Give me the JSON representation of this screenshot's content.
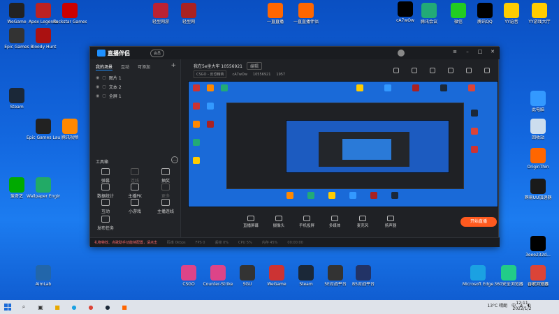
{
  "desktop": {
    "icons_left": [
      {
        "label": "WeGame",
        "color": "#222"
      },
      {
        "label": "Apex Legends",
        "color": "#b22"
      },
      {
        "label": "Rockstar Games",
        "color": "#c00"
      },
      {
        "label": "Epic Games",
        "color": "#333"
      },
      {
        "label": "Bloody Hunt",
        "color": "#a11"
      },
      {
        "label": "Steam",
        "color": "#1b2838"
      },
      {
        "label": "Epic Games Launcher",
        "color": "#222"
      },
      {
        "label": "腾讯视频",
        "color": "#f80"
      },
      {
        "label": "爱奇艺",
        "color": "#0a0"
      },
      {
        "label": "Wallpaper Engine",
        "color": "#2a6"
      },
      {
        "label": "AimLab",
        "color": "#26a"
      }
    ],
    "icons_top": [
      {
        "label": "轻型网游",
        "color": "#b23"
      },
      {
        "label": "轻型网",
        "color": "#a22"
      },
      {
        "label": "一直直播",
        "color": "#f60"
      },
      {
        "label": "一直直播伴侣",
        "color": "#f60"
      },
      {
        "label": "cA7wOw",
        "color": "#000"
      },
      {
        "label": "腾讯会议",
        "color": "#2a7"
      },
      {
        "label": "微信",
        "color": "#2c2"
      },
      {
        "label": "腾讯QQ",
        "color": "#000"
      },
      {
        "label": "YY语音",
        "color": "#fc0"
      },
      {
        "label": "YY游戏大厅",
        "color": "#fc0"
      }
    ],
    "icons_right": [
      {
        "label": "此电脑",
        "color": "#39f"
      },
      {
        "label": "回收站",
        "color": "#cde"
      },
      {
        "label": "OriginThin",
        "color": "#f60"
      },
      {
        "label": "网易UU加速器",
        "color": "#1a1a1a"
      },
      {
        "label": "3eee232d...",
        "color": "#000"
      },
      {
        "label": "谷歌浏览器",
        "color": "#db4437"
      }
    ],
    "icons_bottom": [
      {
        "label": "CSGO",
        "color": "#d48"
      },
      {
        "label": "Counter-Strike",
        "color": "#d48"
      },
      {
        "label": "SGU",
        "color": "#333"
      },
      {
        "label": "WeGame",
        "color": "#c33"
      },
      {
        "label": "Steam",
        "color": "#1b2838"
      },
      {
        "label": "5E对战平台",
        "color": "#333"
      },
      {
        "label": "B5对战平台",
        "color": "#236"
      },
      {
        "label": "Microsoft Edge",
        "color": "#1ba1e2"
      },
      {
        "label": "360安全浏览器",
        "color": "#2c8"
      },
      {
        "label": "谷歌浏览器",
        "color": "#db4437"
      }
    ]
  },
  "app": {
    "name": "直播伴侣",
    "vip_badge": "会员",
    "tabs": [
      "我的场景",
      "互动",
      "可添加"
    ],
    "layers": [
      "图片 1",
      "文本 2",
      "全屏 1"
    ],
    "tools_title": "工具箱",
    "tools": [
      {
        "label": "弹幕",
        "dim": false
      },
      {
        "label": "连线",
        "dim": true
      },
      {
        "label": "抽奖",
        "dim": false
      },
      {
        "label": "数据统计",
        "dim": false
      },
      {
        "label": "主播PK",
        "dim": false
      },
      {
        "label": "更多",
        "dim": true
      },
      {
        "label": "互动",
        "dim": false
      },
      {
        "label": "小游戏",
        "dim": false
      },
      {
        "label": "主播连线",
        "dim": false
      },
      {
        "label": "发布任务",
        "dim": false
      }
    ],
    "stream_title": "我在5e坐大牢 10556921",
    "edit_label": "编辑",
    "meta_game": "CSGO - 反恐精英",
    "meta_user": "cA7wOw",
    "meta_id": "10556921",
    "meta_hot": "1957",
    "bottom_buttons": [
      "直播屏幕",
      "摄像头",
      "手机投屏",
      "多媒体",
      "麦克风",
      "扬声器"
    ],
    "start_live": "开始直播",
    "status_warning": "礼物特效、点歌助手功能待配置，请点击",
    "status_stats": [
      "码率 0kbps",
      "FPS 0",
      "丢帧 0%",
      "CPU 5%",
      "内存 45%"
    ],
    "status_time": "00:00:00"
  },
  "taskbar": {
    "weather": "13°C 晴朗",
    "time": "12:11",
    "date": "2022/1/2",
    "ime": "中"
  }
}
